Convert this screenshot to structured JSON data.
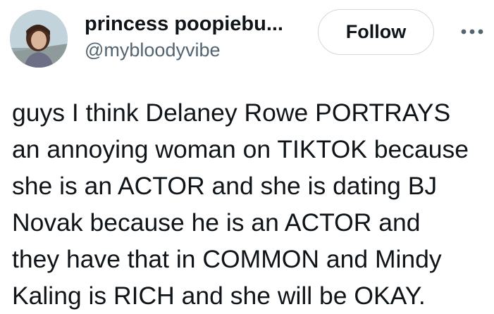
{
  "author": {
    "display_name": "princess poopiebu...",
    "handle": "@mybloodyvibe",
    "avatar_alt": "profile photo"
  },
  "actions": {
    "follow_label": "Follow",
    "more_icon": "more-horizontal-icon"
  },
  "tweet": {
    "text": "guys I think Delaney Rowe PORTRAYS\nan annoying woman on TIKTOK because\nshe is an ACTOR and she is dating BJ\nNovak because he is an ACTOR and\nthey have that in COMMON and Mindy\nKaling is RICH and she will be OKAY."
  },
  "colors": {
    "text_primary": "#0f1419",
    "text_secondary": "#536471",
    "button_border": "#cfd9de"
  }
}
